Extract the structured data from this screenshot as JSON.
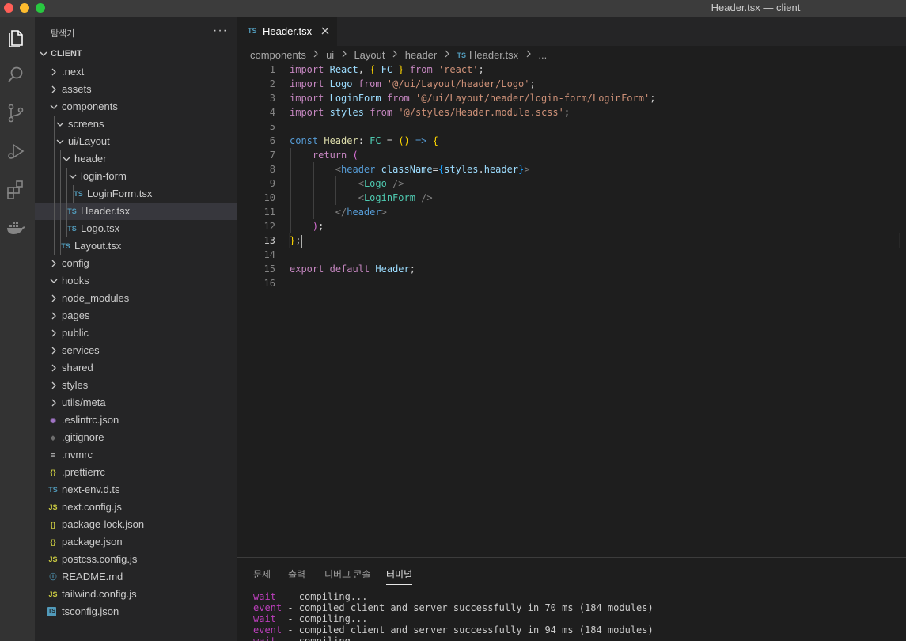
{
  "window": {
    "title": "Header.tsx — client"
  },
  "colors": {
    "ts_badge": "#519aba",
    "js_badge": "#cbcb41",
    "json_badge": "#cbcb41",
    "eslint_badge": "#a074c4",
    "info_badge": "#519aba"
  },
  "activity_bar": {
    "icons": [
      "files-icon",
      "search-icon",
      "source-control-icon",
      "run-debug-icon",
      "extensions-icon",
      "docker-icon"
    ]
  },
  "sidebar": {
    "title": "탐색기",
    "more": "···",
    "section": "CLIENT",
    "tree": [
      {
        "label": ".next",
        "type": "folder",
        "depth": 0,
        "open": false
      },
      {
        "label": "assets",
        "type": "folder",
        "depth": 0,
        "open": false
      },
      {
        "label": "components",
        "type": "folder",
        "depth": 0,
        "open": true
      },
      {
        "label": "screens",
        "type": "folder",
        "depth": 1,
        "open": true
      },
      {
        "label": "ui/Layout",
        "type": "folder",
        "depth": 1,
        "open": true
      },
      {
        "label": "header",
        "type": "folder",
        "depth": 2,
        "open": true
      },
      {
        "label": "login-form",
        "type": "folder",
        "depth": 3,
        "open": true
      },
      {
        "label": "LoginForm.tsx",
        "type": "ts",
        "depth": 4
      },
      {
        "label": "Header.tsx",
        "type": "ts",
        "depth": 3,
        "selected": true
      },
      {
        "label": "Logo.tsx",
        "type": "ts",
        "depth": 3
      },
      {
        "label": "Layout.tsx",
        "type": "ts",
        "depth": 2
      },
      {
        "label": "config",
        "type": "folder",
        "depth": 0,
        "open": false
      },
      {
        "label": "hooks",
        "type": "folder",
        "depth": 0,
        "open": true
      },
      {
        "label": "node_modules",
        "type": "folder",
        "depth": 0,
        "open": false
      },
      {
        "label": "pages",
        "type": "folder",
        "depth": 0,
        "open": false
      },
      {
        "label": "public",
        "type": "folder",
        "depth": 0,
        "open": false
      },
      {
        "label": "services",
        "type": "folder",
        "depth": 0,
        "open": false
      },
      {
        "label": "shared",
        "type": "folder",
        "depth": 0,
        "open": false
      },
      {
        "label": "styles",
        "type": "folder",
        "depth": 0,
        "open": false
      },
      {
        "label": "utils/meta",
        "type": "folder",
        "depth": 0,
        "open": false
      },
      {
        "label": ".eslintrc.json",
        "type": "eslint",
        "depth": 0
      },
      {
        "label": ".gitignore",
        "type": "git",
        "depth": 0
      },
      {
        "label": ".nvmrc",
        "type": "lines",
        "depth": 0
      },
      {
        "label": ".prettierrc",
        "type": "json",
        "depth": 0
      },
      {
        "label": "next-env.d.ts",
        "type": "ts",
        "depth": 0
      },
      {
        "label": "next.config.js",
        "type": "js",
        "depth": 0
      },
      {
        "label": "package-lock.json",
        "type": "json",
        "depth": 0
      },
      {
        "label": "package.json",
        "type": "json",
        "depth": 0
      },
      {
        "label": "postcss.config.js",
        "type": "js",
        "depth": 0
      },
      {
        "label": "README.md",
        "type": "info",
        "depth": 0
      },
      {
        "label": "tailwind.config.js",
        "type": "js",
        "depth": 0
      },
      {
        "label": "tsconfig.json",
        "type": "tsconfig",
        "depth": 0
      }
    ]
  },
  "tab": {
    "badge": "TS",
    "label": "Header.tsx"
  },
  "breadcrumb": {
    "parts": [
      "components",
      "ui",
      "Layout",
      "header"
    ],
    "file_badge": "TS",
    "file": "Header.tsx",
    "more": "..."
  },
  "editor": {
    "current_line": 13,
    "line_numbers": [
      "1",
      "2",
      "3",
      "4",
      "5",
      "6",
      "7",
      "8",
      "9",
      "10",
      "11",
      "12",
      "13",
      "14",
      "15",
      "16"
    ]
  },
  "panel": {
    "tabs": [
      "문제",
      "출력",
      "디버그 콘솔",
      "터미널"
    ],
    "active_tab": "터미널",
    "terminal_lines": [
      {
        "level": "wait",
        "text": "  - compiling..."
      },
      {
        "level": "event",
        "text": " - compiled client and server successfully in 70 ms (184 modules)"
      },
      {
        "level": "wait",
        "text": "  - compiling..."
      },
      {
        "level": "event",
        "text": " - compiled client and server successfully in 94 ms (184 modules)"
      },
      {
        "level": "wait",
        "text": "  - compiling..."
      }
    ]
  }
}
